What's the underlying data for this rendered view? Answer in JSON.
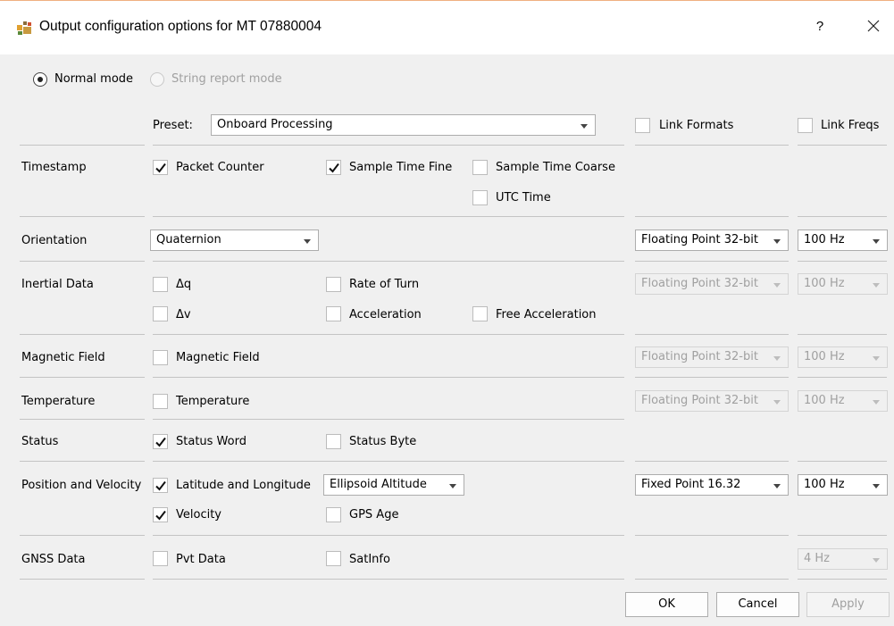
{
  "window": {
    "title": "Output configuration options for MT 07880004",
    "help_label": "?",
    "icons": {
      "app": "xsens-app-icon",
      "close": "close-icon"
    }
  },
  "mode": {
    "normal": {
      "label": "Normal mode",
      "selected": true
    },
    "string_report": {
      "label": "String report mode",
      "selected": false,
      "enabled": false
    }
  },
  "header": {
    "preset_label": "Preset:",
    "preset_value": "Onboard Processing",
    "link_formats": {
      "label": "Link Formats",
      "checked": false
    },
    "link_freqs": {
      "label": "Link Freqs",
      "checked": false
    }
  },
  "rows": {
    "timestamp": {
      "label": "Timestamp",
      "packet_counter": {
        "label": "Packet Counter",
        "checked": true
      },
      "sample_time_fine": {
        "label": "Sample Time Fine",
        "checked": true
      },
      "sample_time_coarse": {
        "label": "Sample Time Coarse",
        "checked": false
      },
      "utc_time": {
        "label": "UTC Time",
        "checked": false
      }
    },
    "orientation": {
      "label": "Orientation",
      "mode": "Quaternion",
      "format": "Floating Point 32-bit",
      "freq": "100 Hz"
    },
    "inertial": {
      "label": "Inertial Data",
      "dq": {
        "label": "Δq",
        "checked": false
      },
      "rate_of_turn": {
        "label": "Rate of Turn",
        "checked": false
      },
      "dv": {
        "label": "Δv",
        "checked": false
      },
      "acceleration": {
        "label": "Acceleration",
        "checked": false
      },
      "free_acceleration": {
        "label": "Free Acceleration",
        "checked": false
      },
      "format": "Floating Point 32-bit",
      "freq": "100 Hz"
    },
    "magnetic": {
      "label": "Magnetic Field",
      "field": {
        "label": "Magnetic Field",
        "checked": false
      },
      "format": "Floating Point 32-bit",
      "freq": "100 Hz"
    },
    "temperature": {
      "label": "Temperature",
      "temp": {
        "label": "Temperature",
        "checked": false
      },
      "format": "Floating Point 32-bit",
      "freq": "100 Hz"
    },
    "status": {
      "label": "Status",
      "status_word": {
        "label": "Status Word",
        "checked": true
      },
      "status_byte": {
        "label": "Status Byte",
        "checked": false
      }
    },
    "position": {
      "label": "Position and Velocity",
      "lat_lon": {
        "label": "Latitude and Longitude",
        "checked": true
      },
      "altitude": "Ellipsoid Altitude",
      "velocity": {
        "label": "Velocity",
        "checked": true
      },
      "gps_age": {
        "label": "GPS Age",
        "checked": false
      },
      "format": "Fixed Point 16.32",
      "freq": "100 Hz"
    },
    "gnss": {
      "label": "GNSS Data",
      "pvt": {
        "label": "Pvt Data",
        "checked": false
      },
      "satinfo": {
        "label": "SatInfo",
        "checked": false
      },
      "freq": "4 Hz"
    }
  },
  "buttons": {
    "ok": "OK",
    "cancel": "Cancel",
    "apply": "Apply"
  },
  "colors": {
    "background": "#f0f0f0",
    "disabled_text": "#a0a0a0",
    "titlebar": "#ffffff"
  }
}
